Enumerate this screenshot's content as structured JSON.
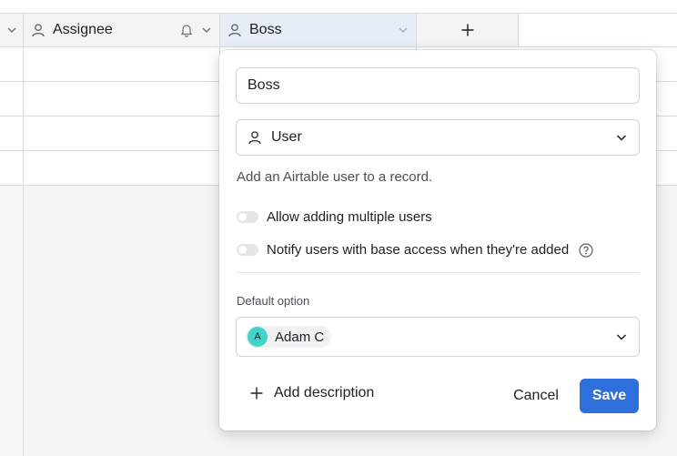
{
  "header": {
    "assignee_label": "Assignee",
    "boss_label": "Boss"
  },
  "popover": {
    "field_name_value": "Boss",
    "field_type_label": "User",
    "type_description": "Add an Airtable user to a record.",
    "toggle_multiple_label": "Allow adding multiple users",
    "toggle_notify_label": "Notify users with base access when they're added",
    "default_option_label": "Default option",
    "default_user_initial": "A",
    "default_user_name": "Adam C",
    "add_description_label": "Add description",
    "cancel_label": "Cancel",
    "save_label": "Save"
  },
  "colors": {
    "accent": "#2d6fdb",
    "avatar": "#3dd6c9",
    "selected_header": "#e6edf7"
  },
  "icons": {
    "user": "user-icon",
    "bell": "bell-icon",
    "chevron": "chevron-down-icon",
    "plus": "plus-icon",
    "help": "help-circle-icon"
  }
}
